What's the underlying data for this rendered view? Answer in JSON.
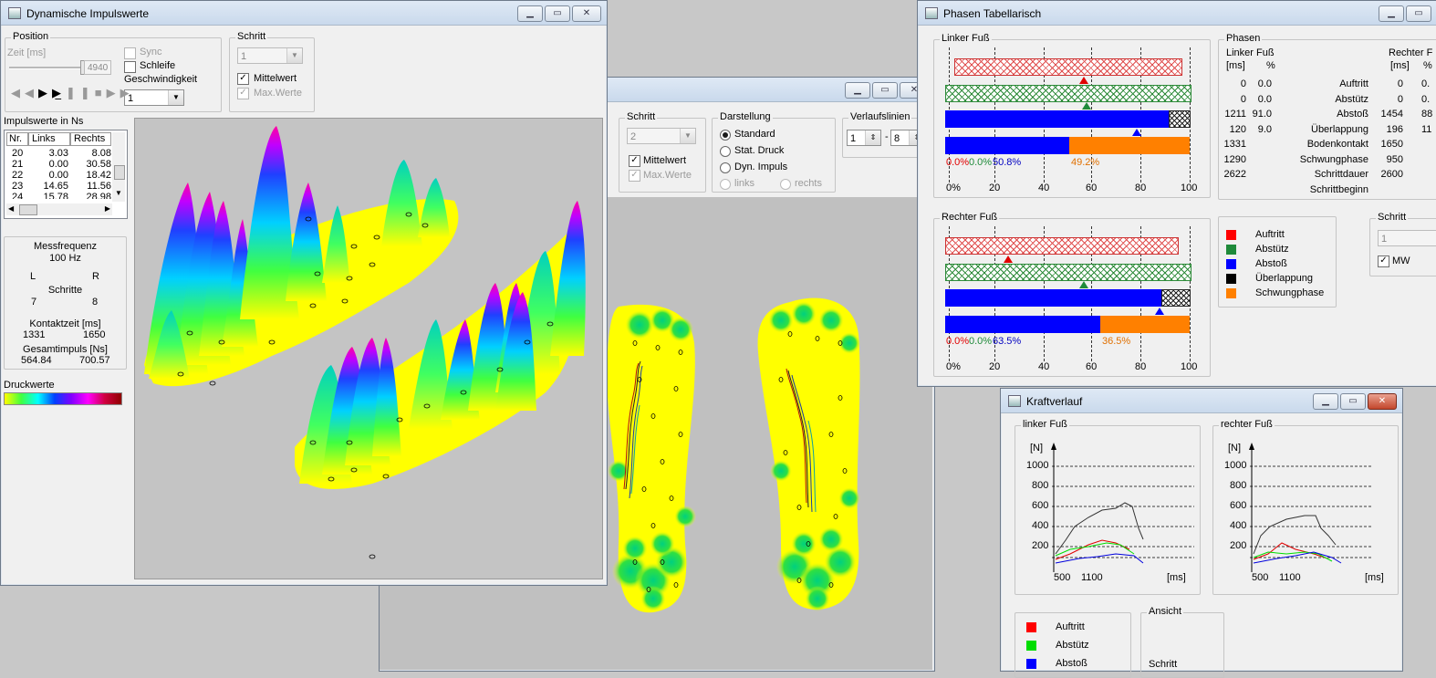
{
  "win_impuls": {
    "title": "Dynamische Impulswerte",
    "position_label": "Position",
    "zeit_label": "Zeit [ms]",
    "zeit_value": "4940",
    "sync_label": "Sync",
    "schleife_label": "Schleife",
    "geschw_label": "Geschwindigkeit",
    "geschw_value": "1",
    "schritt_label": "Schritt",
    "schritt_value": "1",
    "mittelwert_label": "Mittelwert",
    "maxwerte_label": "Max.Werte",
    "impuls_label": "Impulswerte in Ns",
    "table_headers": [
      "Nr.",
      "Links",
      "Rechts"
    ],
    "table_rows": [
      [
        "20",
        "3.03",
        "8.08"
      ],
      [
        "21",
        "0.00",
        "30.58"
      ],
      [
        "22",
        "0.00",
        "18.42"
      ],
      [
        "23",
        "14.65",
        "11.56"
      ],
      [
        "24",
        "15.78",
        "28.98"
      ]
    ],
    "messfreq_label": "Messfrequenz",
    "messfreq_value": "100 Hz",
    "l_label": "L",
    "r_label": "R",
    "schritte_label": "Schritte",
    "schritte_l": "7",
    "schritte_r": "8",
    "kontakt_label": "Kontaktzeit [ms]",
    "kontakt_l": "1331",
    "kontakt_r": "1650",
    "gesamt_label": "Gesamtimpuls [Ns]",
    "gesamt_l": "564.84",
    "gesamt_r": "700.57",
    "druck_label": "Druckwerte"
  },
  "win_middle": {
    "schritt_label": "Schritt",
    "schritt_value": "2",
    "mittelwert_label": "Mittelwert",
    "maxwerte_label": "Max.Werte",
    "darstellung_label": "Darstellung",
    "options": [
      "Standard",
      "Stat. Druck",
      "Dyn. Impuls"
    ],
    "links_label": "links",
    "rechts_label": "rechts",
    "verlauf_label": "Verlaufslinien",
    "verlauf_from": "1",
    "verlauf_to": "8"
  },
  "win_phasen": {
    "title": "Phasen Tabellarisch",
    "linker_label": "Linker Fuß",
    "rechter_label": "Rechter Fuß",
    "linker_pcts": [
      "0.0%",
      "0.0%",
      "50.8%",
      "49.2%"
    ],
    "rechter_pcts": [
      "0.0%",
      "0.0%",
      "63.5%",
      "36.5%"
    ],
    "axis_ticks": [
      "0%",
      "20",
      "40",
      "60",
      "80",
      "100"
    ],
    "phasen_label": "Phasen",
    "col_linker": "Linker Fuß",
    "col_rechter": "Rechter F",
    "unit_ms": "[ms]",
    "unit_pct": "%",
    "unit_pct_r": "%",
    "rows": [
      {
        "l_ms": "0",
        "l_pct": "0.0",
        "name": "Auftritt",
        "r_ms": "0",
        "r_pct": "0."
      },
      {
        "l_ms": "0",
        "l_pct": "0.0",
        "name": "Abstütz",
        "r_ms": "0",
        "r_pct": "0."
      },
      {
        "l_ms": "1211",
        "l_pct": "91.0",
        "name": "Abstoß",
        "r_ms": "1454",
        "r_pct": "88"
      },
      {
        "l_ms": "120",
        "l_pct": "9.0",
        "name": "Überlappung",
        "r_ms": "196",
        "r_pct": "11"
      },
      {
        "l_ms": "1331",
        "l_pct": "",
        "name": "Bodenkontakt",
        "r_ms": "1650",
        "r_pct": ""
      },
      {
        "l_ms": "1290",
        "l_pct": "",
        "name": "Schwungphase",
        "r_ms": "950",
        "r_pct": ""
      },
      {
        "l_ms": "2622",
        "l_pct": "",
        "name": "Schrittdauer",
        "r_ms": "2600",
        "r_pct": ""
      },
      {
        "l_ms": "",
        "l_pct": "",
        "name": "Schrittbeginn",
        "r_ms": "",
        "r_pct": ""
      }
    ],
    "legend": [
      {
        "name": "Auftritt",
        "color": "#ff0000"
      },
      {
        "name": "Abstütz",
        "color": "#1f8a3a"
      },
      {
        "name": "Abstoß",
        "color": "#0000ff"
      },
      {
        "name": "Überlappung",
        "color": "#000000"
      },
      {
        "name": "Schwungphase",
        "color": "#ff8000"
      }
    ],
    "schritt_label": "Schritt",
    "schritt_value": "1",
    "mw_label": "MW"
  },
  "win_kraft": {
    "title": "Kraftverlauf",
    "linker_label": "linker Fuß",
    "rechter_label": "rechter Fuß",
    "y_unit": "[N]",
    "x_unit": "[ms]",
    "y_ticks": [
      "1000",
      "800",
      "600",
      "400",
      "200"
    ],
    "x_ticks": [
      "500",
      "1100"
    ],
    "legend": [
      {
        "name": "Auftritt",
        "color": "#ff0000"
      },
      {
        "name": "Abstütz",
        "color": "#00dd00"
      },
      {
        "name": "Abstoß",
        "color": "#0000ff"
      }
    ],
    "ansicht_label": "Ansicht",
    "schritt_label": "Schritt"
  }
}
